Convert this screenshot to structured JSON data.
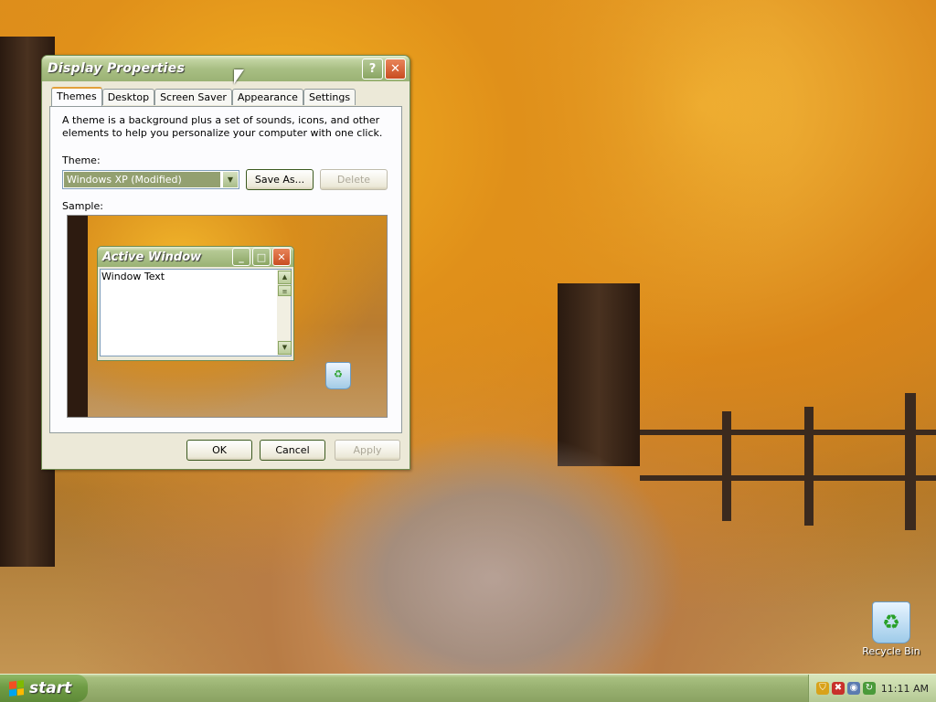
{
  "window": {
    "title": "Display Properties",
    "help_glyph": "?",
    "close_glyph": "✕",
    "tabs": [
      {
        "label": "Themes",
        "active": true
      },
      {
        "label": "Desktop",
        "active": false
      },
      {
        "label": "Screen Saver",
        "active": false
      },
      {
        "label": "Appearance",
        "active": false
      },
      {
        "label": "Settings",
        "active": false
      }
    ],
    "description": "A theme is a background plus a set of sounds, icons, and other elements to help you personalize your computer with one click.",
    "theme_label": "Theme:",
    "theme_value": "Windows XP (Modified)",
    "save_as_label": "Save As...",
    "delete_label": "Delete",
    "sample_label": "Sample:",
    "sample": {
      "window_title": "Active Window",
      "window_text": "Window Text"
    },
    "ok_label": "OK",
    "cancel_label": "Cancel",
    "apply_label": "Apply"
  },
  "desktop": {
    "recycle_bin_label": "Recycle Bin"
  },
  "taskbar": {
    "start_label": "start",
    "clock": "11:11 AM",
    "tray_icons": [
      "shield-icon",
      "security-alert-icon",
      "network-icon",
      "update-icon"
    ]
  },
  "colors": {
    "title_green": "#9ab274",
    "close_red": "#c84d21",
    "dialog_bg": "#ece9d8"
  }
}
